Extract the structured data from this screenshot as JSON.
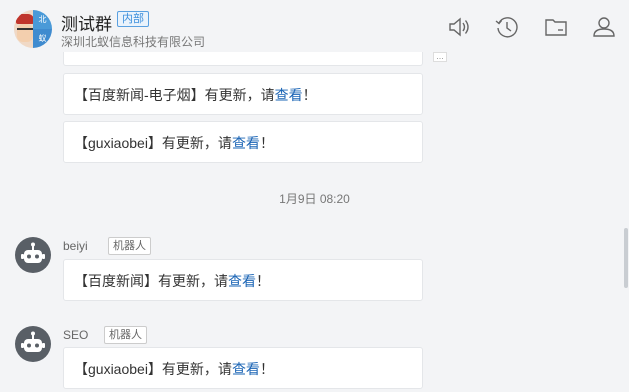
{
  "header": {
    "title": "测试群",
    "tag": "内部",
    "subtitle": "深圳北蚁信息科技有限公司",
    "avatar_chars": [
      "北",
      "蚁"
    ],
    "icons": [
      "speaker-icon",
      "history-icon",
      "folder-icon",
      "members-icon"
    ]
  },
  "messages": [
    {
      "prefix": "【百度新闻-电子烟】有更新，请",
      "link": "查看",
      "suffix": "！"
    },
    {
      "prefix": "【guxiaobei】有更新，请",
      "link": "查看",
      "suffix": "！"
    }
  ],
  "timestamp": "1月9日 08:20",
  "later_messages": [
    {
      "sender": "beiyi",
      "tag": "机器人",
      "prefix": "【百度新闻】有更新，请",
      "link": "查看",
      "suffix": "！"
    },
    {
      "sender": "SEO",
      "tag": "机器人",
      "prefix": "【guxiaobei】有更新，请",
      "link": "查看",
      "suffix": "！"
    }
  ],
  "more_indicator": "...",
  "colors": {
    "link": "#1a64b5",
    "tag_blue": "#3c8fdc",
    "background": "#f3f4f6"
  }
}
